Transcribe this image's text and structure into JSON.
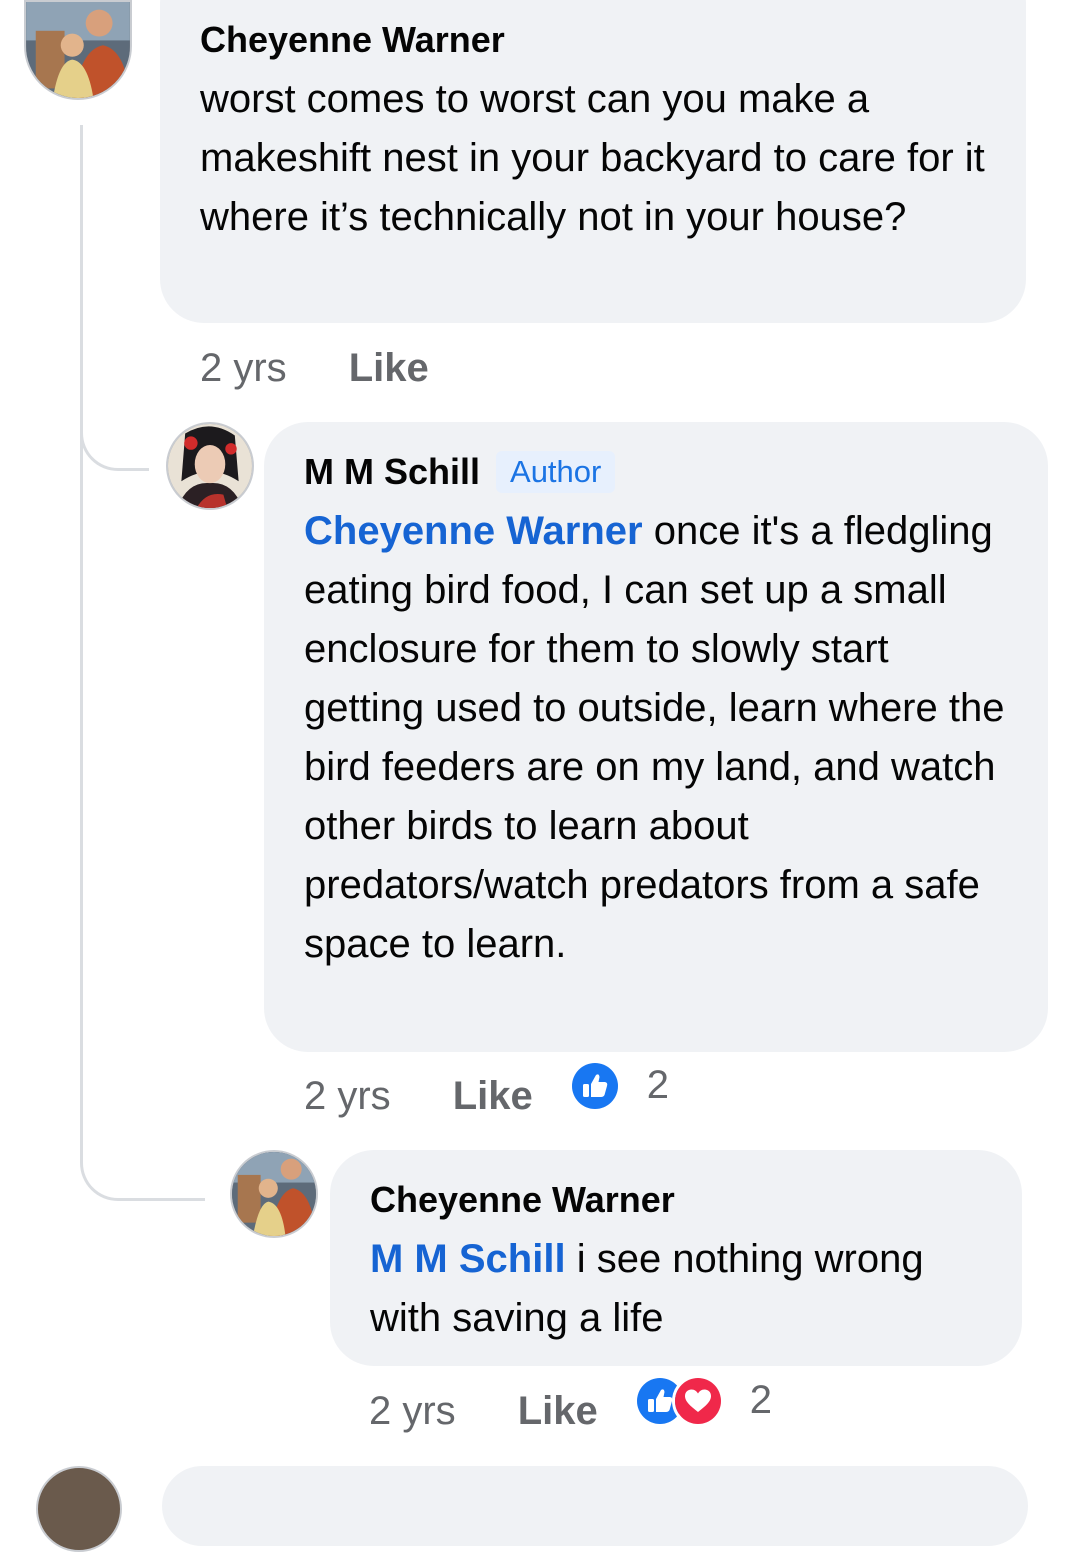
{
  "comments": [
    {
      "author": "Cheyenne Warner",
      "text": "worst comes to worst can you make a makeshift nest in your backyard to care for it where it’s technically not in your house?",
      "time": "2 yrs",
      "like_label": "Like"
    },
    {
      "author": "M M Schill",
      "badge": "Author",
      "mention": "Cheyenne Warner",
      "text": " once it's a fledgling eating bird food, I can set up a small enclosure for them to slowly start getting used to outside, learn where the bird feeders are on my land, and watch other birds to learn about predators/watch predators from a safe space to learn.",
      "time": "2 yrs",
      "like_label": "Like",
      "reaction_count": "2",
      "reactions": [
        "like-icon"
      ]
    },
    {
      "author": "Cheyenne Warner",
      "mention": "M M Schill",
      "text": " i see nothing wrong with saving a life",
      "time": "2 yrs",
      "like_label": "Like",
      "reaction_count": "2",
      "reactions": [
        "like-icon",
        "love-icon"
      ]
    }
  ],
  "colors": {
    "bubble": "#f0f2f5",
    "mention": "#1664d3",
    "meta": "#65676b",
    "like_reaction": "#1877f2",
    "love_reaction": "#f0284a"
  }
}
